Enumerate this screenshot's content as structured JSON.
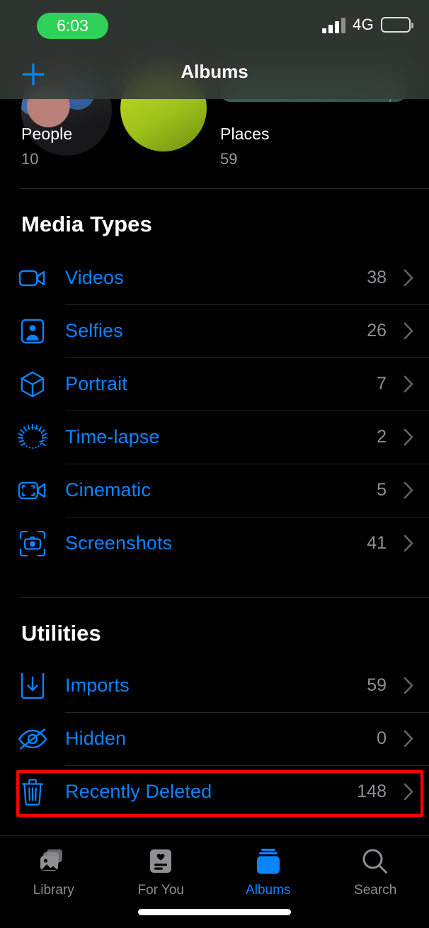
{
  "status_bar": {
    "time": "6:03",
    "network": "4G",
    "signal_icon": "cellular-signal-icon",
    "battery_icon": "battery-icon"
  },
  "nav": {
    "title": "Albums",
    "add_icon": "plus-icon"
  },
  "album_strip": {
    "items": [
      {
        "name": "People",
        "count": "10",
        "thumb": "people-thumbnail"
      },
      {
        "name": "Places",
        "count": "59",
        "thumb": "places-map-thumbnail"
      }
    ]
  },
  "sections": [
    {
      "title": "Media Types",
      "rows": [
        {
          "label": "Videos",
          "count": "38",
          "icon": "video-camera-icon"
        },
        {
          "label": "Selfies",
          "count": "26",
          "icon": "person-in-frame-icon"
        },
        {
          "label": "Portrait",
          "count": "7",
          "icon": "cube-icon"
        },
        {
          "label": "Time-lapse",
          "count": "2",
          "icon": "timelapse-icon"
        },
        {
          "label": "Cinematic",
          "count": "5",
          "icon": "cinematic-video-icon"
        },
        {
          "label": "Screenshots",
          "count": "41",
          "icon": "screenshot-camera-icon"
        }
      ]
    },
    {
      "title": "Utilities",
      "rows": [
        {
          "label": "Imports",
          "count": "59",
          "icon": "import-tray-icon"
        },
        {
          "label": "Hidden",
          "count": "0",
          "icon": "eye-slash-icon"
        },
        {
          "label": "Recently Deleted",
          "count": "148",
          "icon": "trash-icon"
        }
      ]
    }
  ],
  "highlight": {
    "target_label": "Recently Deleted",
    "color": "#fe0000"
  },
  "tabbar": {
    "items": [
      {
        "label": "Library",
        "icon": "photo-stack-icon",
        "active": false
      },
      {
        "label": "For You",
        "icon": "heart-card-icon",
        "active": false
      },
      {
        "label": "Albums",
        "icon": "albums-stack-icon",
        "active": true
      },
      {
        "label": "Search",
        "icon": "magnifier-icon",
        "active": false
      }
    ]
  },
  "colors": {
    "accent": "#0a84ff",
    "background": "#000000",
    "secondary_text": "#8e8e93",
    "highlight": "#fe0000",
    "status_pill": "#30d158"
  }
}
